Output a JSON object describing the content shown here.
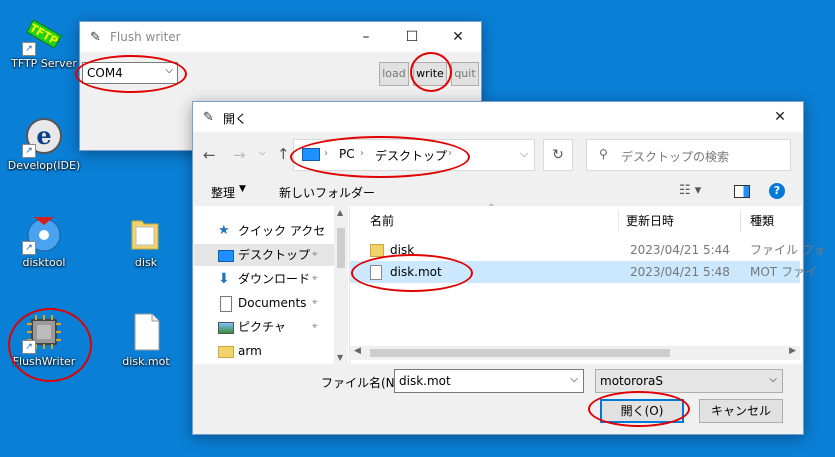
{
  "desktop": {
    "icons": [
      {
        "label": "TFTP Server",
        "icon": "tftp-server-icon"
      },
      {
        "label": "Develop(IDE)",
        "icon": "develop-ide-icon"
      },
      {
        "label": "disktool",
        "icon": "disktool-icon"
      },
      {
        "label": "disk",
        "icon": "folder-icon"
      },
      {
        "label": "FlushWriter",
        "icon": "chip-icon"
      },
      {
        "label": "disk.mot",
        "icon": "file-icon"
      }
    ]
  },
  "flush_writer": {
    "title": "Flush writer",
    "port_value": "COM4",
    "buttons": {
      "load": "load",
      "write": "write",
      "quit": "quit"
    }
  },
  "open_dialog": {
    "title": "開く",
    "breadcrumb": {
      "root": "PC",
      "current": "デスクトップ"
    },
    "search_placeholder": "デスクトップの検索",
    "toolbar": {
      "organize": "整理",
      "new_folder": "新しいフォルダー"
    },
    "nav_pane": [
      {
        "label": "クイック アクセス",
        "icon": "star-icon",
        "pinned": false
      },
      {
        "label": "デスクトップ",
        "icon": "desktop-icon",
        "pinned": true
      },
      {
        "label": "ダウンロード",
        "icon": "download-icon",
        "pinned": true
      },
      {
        "label": "Documents",
        "icon": "documents-icon",
        "pinned": true
      },
      {
        "label": "ピクチャ",
        "icon": "pictures-icon",
        "pinned": true
      },
      {
        "label": "arm",
        "icon": "folder-icon",
        "pinned": false
      }
    ],
    "columns": {
      "name": "名前",
      "modified": "更新日時",
      "type": "種類"
    },
    "files": [
      {
        "name": "disk",
        "modified": "2023/04/21 5:44",
        "type": "ファイル フォ",
        "icon": "folder-icon"
      },
      {
        "name": "disk.mot",
        "modified": "2023/04/21 5:48",
        "type": "MOT ファイ",
        "icon": "file-icon"
      }
    ],
    "filename_label": "ファイル名(N):",
    "filename_value": "disk.mot",
    "filter_value": "motororaS",
    "buttons": {
      "open": "開く(O)",
      "cancel": "キャンセル"
    }
  },
  "colors": {
    "desktop": "#0a7fd6",
    "selection": "#cce8ff",
    "accent": "#0078d7",
    "annotation": "#e00000"
  }
}
